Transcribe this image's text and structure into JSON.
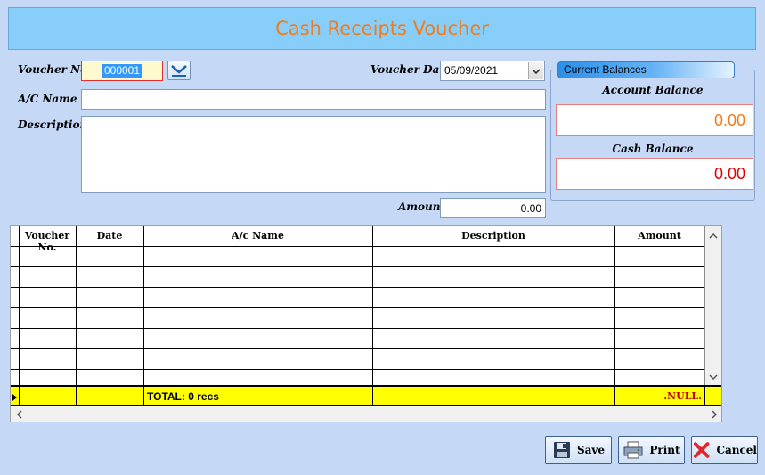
{
  "header": {
    "title": "Cash Receipts Voucher"
  },
  "form": {
    "voucher_no_label": "Voucher No.",
    "voucher_no_value": "000001",
    "voucher_date_label": "Voucher Date",
    "voucher_date_value": "05/09/2021",
    "ac_name_label": "A/C Name",
    "ac_name_value": "",
    "description_label": "Description",
    "description_value": "",
    "amount_label": "Amount",
    "amount_value": "0.00"
  },
  "balances": {
    "title": "Current Balances",
    "account_balance_label": "Account Balance",
    "account_balance_value": "0.00",
    "cash_balance_label": "Cash Balance",
    "cash_balance_value": "0.00"
  },
  "grid": {
    "columns": [
      "Voucher No.",
      "Date",
      "A/c Name",
      "Description",
      "Amount"
    ],
    "footer_total": "TOTAL: 0 recs",
    "footer_amount": ".NULL."
  },
  "buttons": {
    "save": "Save",
    "print": "Print",
    "cancel": "Cancel"
  },
  "colors": {
    "background": "#c5d9f7",
    "header": "#87cefa",
    "title": "#f07c1c",
    "footer_row": "#ffff00",
    "cash_balance": "#e00000",
    "account_balance": "#f07c1c"
  }
}
